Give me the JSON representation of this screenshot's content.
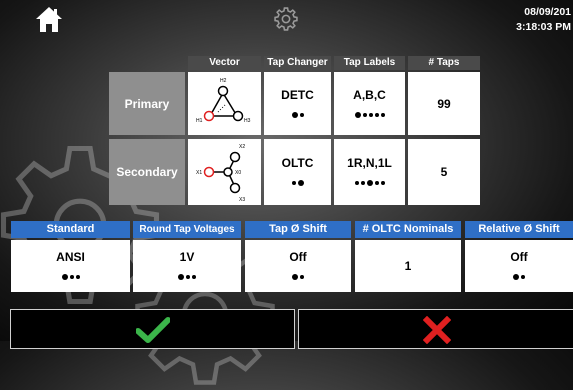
{
  "header": {
    "date": "08/09/201",
    "time": "3:18:03 PM"
  },
  "table": {
    "columns": [
      "Vector",
      "Tap Changer",
      "Tap Labels",
      "# Taps"
    ],
    "rows": [
      {
        "label": "Primary",
        "vector": {
          "terminals": [
            "H2",
            "H1",
            "H3"
          ]
        },
        "tap_changer": {
          "value": "DETC",
          "selected_index": 0,
          "options_count": 2
        },
        "tap_labels": {
          "value": "A,B,C",
          "selected_index": 0,
          "options_count": 5
        },
        "taps": {
          "value": "99"
        }
      },
      {
        "label": "Secondary",
        "vector": {
          "terminals": [
            "X2",
            "X1",
            "X0",
            "X3"
          ]
        },
        "tap_changer": {
          "value": "OLTC",
          "selected_index": 1,
          "options_count": 2
        },
        "tap_labels": {
          "value": "1R,N,1L",
          "selected_index": 2,
          "options_count": 5
        },
        "taps": {
          "value": "5"
        }
      }
    ]
  },
  "settings": [
    {
      "label": "Standard",
      "value": "ANSI",
      "selected_index": 0,
      "options_count": 3
    },
    {
      "label": "Round Tap Voltages",
      "value": "1V",
      "selected_index": 0,
      "options_count": 3
    },
    {
      "label": "Tap Ø Shift",
      "value": "Off",
      "selected_index": 0,
      "options_count": 2
    },
    {
      "label": "# OLTC Nominals",
      "value": "1",
      "selected_index": -1,
      "options_count": 0
    },
    {
      "label": "Relative Ø Shift",
      "value": "Off",
      "selected_index": 0,
      "options_count": 2
    }
  ],
  "colors": {
    "accent_blue": "#2f6fc6",
    "confirm_green": "#3bb54a",
    "cancel_red": "#e02020",
    "header_gray": "#4a4a4a",
    "row_label_gray": "#8f8f8f",
    "vector_red": "#e02020"
  },
  "icons": {
    "home": "home-icon",
    "settings": "gear-icon",
    "confirm": "checkmark-icon",
    "cancel": "x-icon"
  }
}
